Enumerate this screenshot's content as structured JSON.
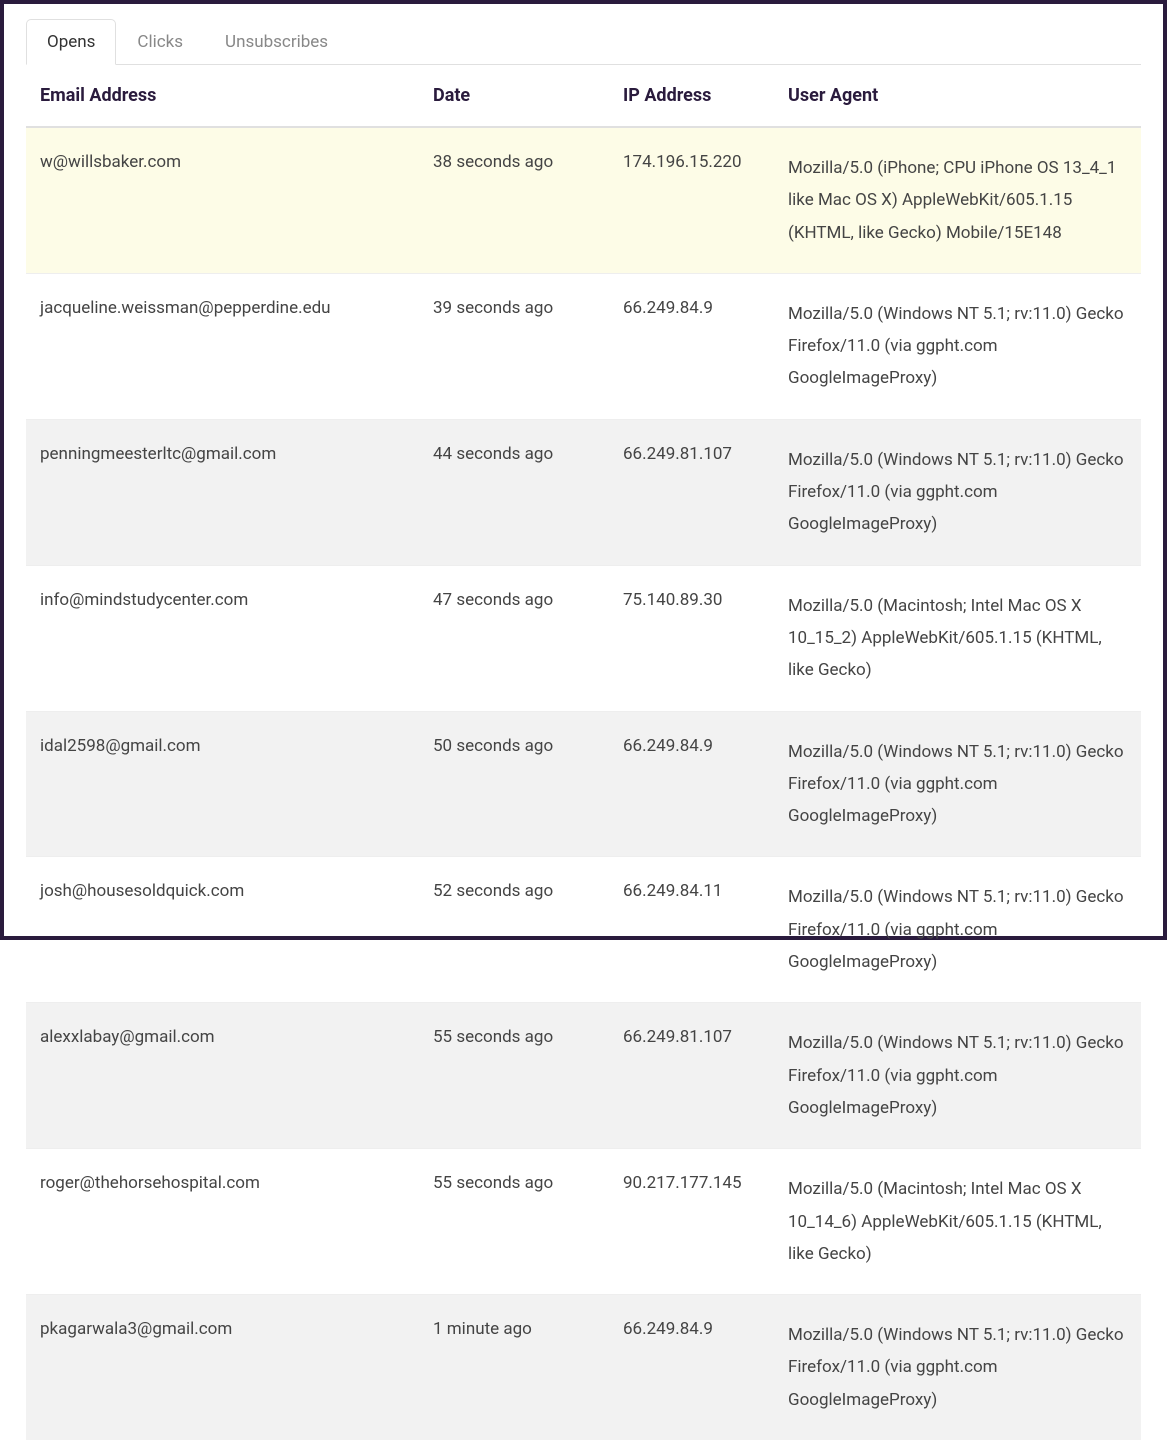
{
  "tabs": [
    {
      "label": "Opens",
      "active": true
    },
    {
      "label": "Clicks",
      "active": false
    },
    {
      "label": "Unsubscribes",
      "active": false
    }
  ],
  "columns": {
    "email": "Email Address",
    "date": "Date",
    "ip": "IP Address",
    "ua": "User Agent"
  },
  "rows": [
    {
      "email": "w@willsbaker.com",
      "date": "38 seconds ago",
      "ip": "174.196.15.220",
      "ua": "Mozilla/5.0 (iPhone; CPU iPhone OS 13_4_1 like Mac OS X) AppleWebKit/605.1.15 (KHTML, like Gecko) Mobile/15E148",
      "highlight": true
    },
    {
      "email": "jacqueline.weissman@pepperdine.edu",
      "date": "39 seconds ago",
      "ip": "66.249.84.9",
      "ua": "Mozilla/5.0 (Windows NT 5.1; rv:11.0) Gecko Firefox/11.0 (via ggpht.com GoogleImageProxy)"
    },
    {
      "email": "penningmeesterltc@gmail.com",
      "date": "44 seconds ago",
      "ip": "66.249.81.107",
      "ua": "Mozilla/5.0 (Windows NT 5.1; rv:11.0) Gecko Firefox/11.0 (via ggpht.com GoogleImageProxy)"
    },
    {
      "email": "info@mindstudycenter.com",
      "date": "47 seconds ago",
      "ip": "75.140.89.30",
      "ua": "Mozilla/5.0 (Macintosh; Intel Mac OS X 10_15_2) AppleWebKit/605.1.15 (KHTML, like Gecko)"
    },
    {
      "email": "idal2598@gmail.com",
      "date": "50 seconds ago",
      "ip": "66.249.84.9",
      "ua": "Mozilla/5.0 (Windows NT 5.1; rv:11.0) Gecko Firefox/11.0 (via ggpht.com GoogleImageProxy)"
    },
    {
      "email": "josh@housesoldquick.com",
      "date": "52 seconds ago",
      "ip": "66.249.84.11",
      "ua": "Mozilla/5.0 (Windows NT 5.1; rv:11.0) Gecko Firefox/11.0 (via ggpht.com GoogleImageProxy)"
    },
    {
      "email": "alexxlabay@gmail.com",
      "date": "55 seconds ago",
      "ip": "66.249.81.107",
      "ua": "Mozilla/5.0 (Windows NT 5.1; rv:11.0) Gecko Firefox/11.0 (via ggpht.com GoogleImageProxy)"
    },
    {
      "email": "roger@thehorsehospital.com",
      "date": "55 seconds ago",
      "ip": "90.217.177.145",
      "ua": "Mozilla/5.0 (Macintosh; Intel Mac OS X 10_14_6) AppleWebKit/605.1.15 (KHTML, like Gecko)"
    },
    {
      "email": "pkagarwala3@gmail.com",
      "date": "1 minute ago",
      "ip": "66.249.84.9",
      "ua": "Mozilla/5.0 (Windows NT 5.1; rv:11.0) Gecko Firefox/11.0 (via ggpht.com GoogleImageProxy)"
    }
  ]
}
